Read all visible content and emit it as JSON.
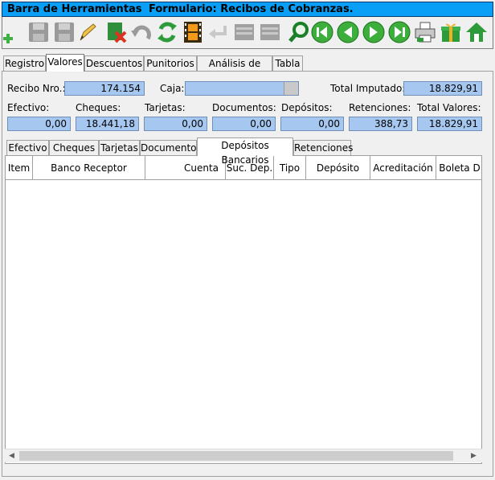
{
  "titlebar": {
    "left": "Barra de Herramientas",
    "right": "Formulario: Recibos de Cobranzas."
  },
  "toolbar": {
    "icons": [
      "add-icon",
      "save-icon",
      "save-disabled-icon",
      "edit-icon",
      "delete-icon",
      "undo-icon",
      "refresh-icon",
      "film-icon",
      "enter-icon",
      "list-icon",
      "list2-icon",
      "search-icon",
      "first-icon",
      "prev-icon",
      "next-icon",
      "last-icon",
      "print-icon",
      "gift-icon",
      "home-icon"
    ]
  },
  "tabs": [
    "Registro",
    "Valores",
    "Descuentos",
    "Punitorios",
    "Análisis de Pago",
    "Tabla"
  ],
  "form": {
    "recibo_label": "Recibo Nro.:",
    "recibo_value": "174.154",
    "caja_label": "Caja:",
    "caja_value": "",
    "total_imputado_label": "Total Imputado:",
    "total_imputado_value": "18.829,91",
    "efectivo_label": "Efectivo:",
    "efectivo_value": "0,00",
    "cheques_label": "Cheques:",
    "cheques_value": "18.441,18",
    "tarjetas_label": "Tarjetas:",
    "tarjetas_value": "0,00",
    "documentos_label": "Documentos:",
    "documentos_value": "0,00",
    "depositos_label": "Depósitos:",
    "depositos_value": "0,00",
    "retenciones_label": "Retenciones:",
    "retenciones_value": "388,73",
    "total_valores_label": "Total Valores:",
    "total_valores_value": "18.829,91"
  },
  "subtabs": [
    "Efectivo",
    "Cheques",
    "Tarjetas",
    "Documentos",
    "Depósitos Bancarios",
    "Retenciones"
  ],
  "grid": {
    "columns": [
      "Item",
      "Banco Receptor",
      "Cuenta",
      "Suc. Dep.",
      "Tipo",
      "Depósito",
      "Acreditación",
      "Boleta D"
    ]
  },
  "colors": {
    "title_bg": "#0a9ff7",
    "field_bg": "#a6c8f0"
  }
}
